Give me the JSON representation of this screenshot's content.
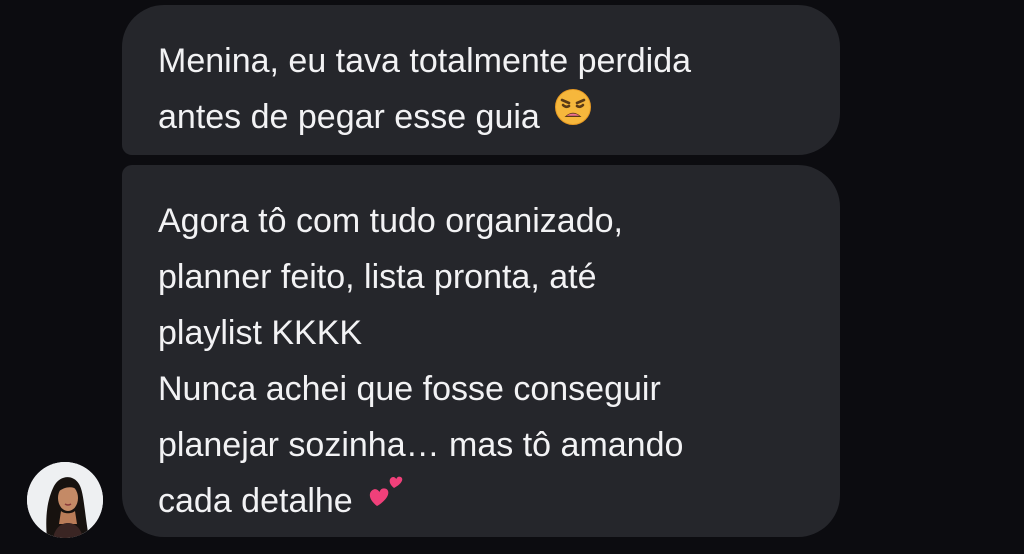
{
  "messages": [
    {
      "lines": [
        "Menina, eu tava totalmente perdida",
        "antes de pegar esse guia"
      ],
      "emoji": "weary-face-icon"
    },
    {
      "lines": [
        "Agora tô com tudo organizado,",
        "planner feito, lista pronta, até",
        "playlist KKKK",
        "Nunca achei que fosse conseguir",
        "planejar sozinha… mas tô amando",
        "cada detalhe"
      ],
      "emoji": "two-hearts-icon"
    }
  ],
  "colors": {
    "background": "#0c0c10",
    "bubble": "#25262b",
    "text": "#f2f2f4",
    "heart": "#f0407a",
    "emoji_face": "#f6b73c"
  }
}
